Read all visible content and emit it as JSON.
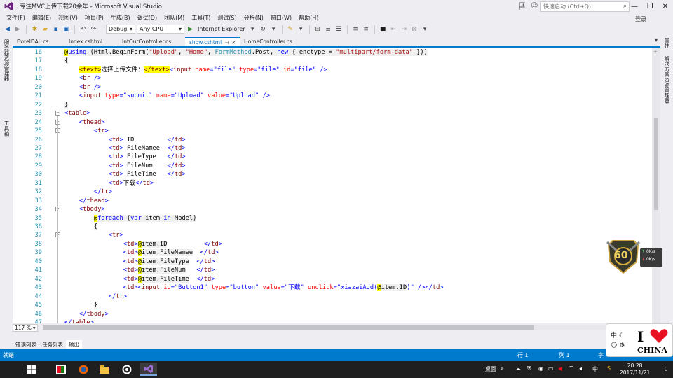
{
  "window": {
    "title": "专注MVC上传下载20余年 - Microsoft Visual Studio",
    "quick_launch_placeholder": "快速启动 (Ctrl+Q)",
    "login": "登录"
  },
  "menu": [
    "文件(F)",
    "编辑(E)",
    "视图(V)",
    "项目(P)",
    "生成(B)",
    "调试(D)",
    "团队(M)",
    "工具(T)",
    "测试(S)",
    "分析(N)",
    "窗口(W)",
    "帮助(H)"
  ],
  "toolbar": {
    "config": "Debug",
    "platform": "Any CPU",
    "run_target": "Internet Explorer"
  },
  "side_left": [
    "服务器资源管理器",
    "工具箱"
  ],
  "side_right": [
    "属性",
    "解决方案资源管理器"
  ],
  "doc_tabs": [
    {
      "label": "ExcelDAL.cs",
      "active": false
    },
    {
      "label": "Index.cshtml",
      "active": false
    },
    {
      "label": "IntOutController.cs",
      "active": false
    },
    {
      "label": "show.cshtml",
      "active": true
    },
    {
      "label": "HomeController.cs",
      "active": false
    }
  ],
  "zoom": "117 %",
  "output_tabs": [
    "错误列表",
    "任务列表",
    "输出"
  ],
  "status": {
    "ready": "就绪",
    "line": "行 1",
    "col": "列 1",
    "char": "字"
  },
  "tray": {
    "desktop": "桌面",
    "ime": "中",
    "time": "20:28",
    "date": "2017/11/21"
  },
  "badge": {
    "value": "60",
    "speed_up": "0K/s",
    "speed_down": "0K/s"
  },
  "promo": {
    "ime_chars": [
      "中",
      "☾",
      "☺",
      "⚙"
    ],
    "letter_i": "I",
    "word": "CHINA"
  },
  "code_lines": [
    {
      "n": "16",
      "html": "<span class='rzbg'><span class='raz'>@</span><span class='kw'>using</span> (Html.BeginForm(<span class='str'>\"Upload\"</span>, <span class='str'>\"Home\"</span>, <span style='color:#2b91af'>FormMethod</span>.Post, <span class='kw'>new</span> { enctype = <span class='str'>\"multipart/form-data\"</span> }))</span>"
    },
    {
      "n": "17",
      "html": "<span class='rzbg'>{</span>"
    },
    {
      "n": "18",
      "html": "    <span class='raz'><span class='tag'>&lt;text&gt;</span></span>选择上传文件：<span class='raz'><span class='tag'>&lt;/text&gt;</span></span><span class='av'>&lt;</span><span class='tag'>input</span> <span class='attr'>name</span><span class='av'>=\"file\"</span> <span class='attr'>type</span><span class='av'>=\"file\"</span> <span class='attr'>id</span><span class='av'>=\"file\"</span> <span class='av'>/&gt;</span>"
    },
    {
      "n": "19",
      "html": "    <span class='av'>&lt;</span><span class='tag'>br</span> <span class='av'>/&gt;</span>"
    },
    {
      "n": "20",
      "html": "    <span class='av'>&lt;</span><span class='tag'>br</span> <span class='av'>/&gt;</span>"
    },
    {
      "n": "21",
      "html": "    <span class='av'>&lt;</span><span class='tag'>input</span> <span class='attr'>type</span><span class='av'>=\"submit\"</span> <span class='attr'>name</span><span class='av'>=\"Upload\"</span> <span class='attr'>value</span><span class='av'>=\"Upload\"</span> <span class='av'>/&gt;</span>"
    },
    {
      "n": "22",
      "html": "<span class='rzbg'>}</span>"
    },
    {
      "n": "23",
      "html": "<span class='av'>&lt;</span><span class='tag'>table</span><span class='av'>&gt;</span>"
    },
    {
      "n": "24",
      "html": "    <span class='av'>&lt;</span><span class='tag'>thead</span><span class='av'>&gt;</span>"
    },
    {
      "n": "25",
      "html": "        <span class='av'>&lt;</span><span class='tag'>tr</span><span class='av'>&gt;</span>"
    },
    {
      "n": "26",
      "html": "            <span class='av'>&lt;</span><span class='tag'>td</span><span class='av'>&gt;</span> ID         <span class='av'>&lt;/</span><span class='tag'>td</span><span class='av'>&gt;</span>"
    },
    {
      "n": "27",
      "html": "            <span class='av'>&lt;</span><span class='tag'>td</span><span class='av'>&gt;</span> FileNamee  <span class='av'>&lt;/</span><span class='tag'>td</span><span class='av'>&gt;</span>"
    },
    {
      "n": "28",
      "html": "            <span class='av'>&lt;</span><span class='tag'>td</span><span class='av'>&gt;</span> FileType   <span class='av'>&lt;/</span><span class='tag'>td</span><span class='av'>&gt;</span>"
    },
    {
      "n": "29",
      "html": "            <span class='av'>&lt;</span><span class='tag'>td</span><span class='av'>&gt;</span> FileNum    <span class='av'>&lt;/</span><span class='tag'>td</span><span class='av'>&gt;</span>"
    },
    {
      "n": "30",
      "html": "            <span class='av'>&lt;</span><span class='tag'>td</span><span class='av'>&gt;</span> FileTime   <span class='av'>&lt;/</span><span class='tag'>td</span><span class='av'>&gt;</span>"
    },
    {
      "n": "31",
      "html": "            <span class='av'>&lt;</span><span class='tag'>td</span><span class='av'>&gt;</span>下载<span class='av'>&lt;/</span><span class='tag'>td</span><span class='av'>&gt;</span>"
    },
    {
      "n": "32",
      "html": "        <span class='av'>&lt;/</span><span class='tag'>tr</span><span class='av'>&gt;</span>"
    },
    {
      "n": "33",
      "html": "    <span class='av'>&lt;/</span><span class='tag'>thead</span><span class='av'>&gt;</span>"
    },
    {
      "n": "34",
      "html": "    <span class='av'>&lt;</span><span class='tag'>tbody</span><span class='av'>&gt;</span>"
    },
    {
      "n": "35",
      "html": "        <span class='rzbg'><span class='raz'>@</span><span class='kw'>foreach</span> (<span class='kw'>var</span> item <span class='kw'>in</span> Model)</span>"
    },
    {
      "n": "36",
      "html": "        <span class='rzbg'>{</span>"
    },
    {
      "n": "37",
      "html": "            <span class='av'>&lt;</span><span class='tag'>tr</span><span class='av'>&gt;</span>"
    },
    {
      "n": "38",
      "html": "                <span class='av'>&lt;</span><span class='tag'>td</span><span class='av'>&gt;</span><span class='rzbg'><span class='raz'>@</span>item.ID</span>          <span class='av'>&lt;/</span><span class='tag'>td</span><span class='av'>&gt;</span>"
    },
    {
      "n": "39",
      "html": "                <span class='av'>&lt;</span><span class='tag'>td</span><span class='av'>&gt;</span><span class='rzbg'><span class='raz'>@</span>item.FileNamee</span>  <span class='av'>&lt;/</span><span class='tag'>td</span><span class='av'>&gt;</span>"
    },
    {
      "n": "40",
      "html": "                <span class='av'>&lt;</span><span class='tag'>td</span><span class='av'>&gt;</span><span class='rzbg'><span class='raz'>@</span>item.FileType</span>  <span class='av'>&lt;/</span><span class='tag'>td</span><span class='av'>&gt;</span>"
    },
    {
      "n": "41",
      "html": "                <span class='av'>&lt;</span><span class='tag'>td</span><span class='av'>&gt;</span><span class='rzbg'><span class='raz'>@</span>item.FileNum</span>   <span class='av'>&lt;/</span><span class='tag'>td</span><span class='av'>&gt;</span>"
    },
    {
      "n": "42",
      "html": "                <span class='av'>&lt;</span><span class='tag'>td</span><span class='av'>&gt;</span><span class='rzbg'><span class='raz'>@</span>item.FileTime</span>  <span class='av'>&lt;/</span><span class='tag'>td</span><span class='av'>&gt;</span>"
    },
    {
      "n": "43",
      "html": "                <span class='av'>&lt;</span><span class='tag'>td</span><span class='av'>&gt;&lt;</span><span class='tag'>input</span> <span class='attr'>id</span><span class='av'>=\"Button1\"</span> <span class='attr'>type</span><span class='av'>=\"button\"</span> <span class='attr'>value</span><span class='av'>=\"下载\"</span> <span class='attr'>onclick</span><span class='av'>=\"xiazaiAdd(</span><span class='rzbg'><span class='raz'>@</span>item.ID</span><span class='av'>)\"</span> <span class='av'>/&gt;&lt;/</span><span class='tag'>td</span><span class='av'>&gt;</span>"
    },
    {
      "n": "44",
      "html": "            <span class='av'>&lt;/</span><span class='tag'>tr</span><span class='av'>&gt;</span>"
    },
    {
      "n": "45",
      "html": "        <span class='rzbg'>}</span>"
    },
    {
      "n": "46",
      "html": "    <span class='av'>&lt;/</span><span class='tag'>tbody</span><span class='av'>&gt;</span>"
    },
    {
      "n": "47",
      "html": "<span class='av'>&lt;/</span><span class='tag'>table</span><span class='av'>&gt;</span>"
    }
  ],
  "fold_lines": [
    "23",
    "24",
    "25",
    "34",
    "37"
  ]
}
